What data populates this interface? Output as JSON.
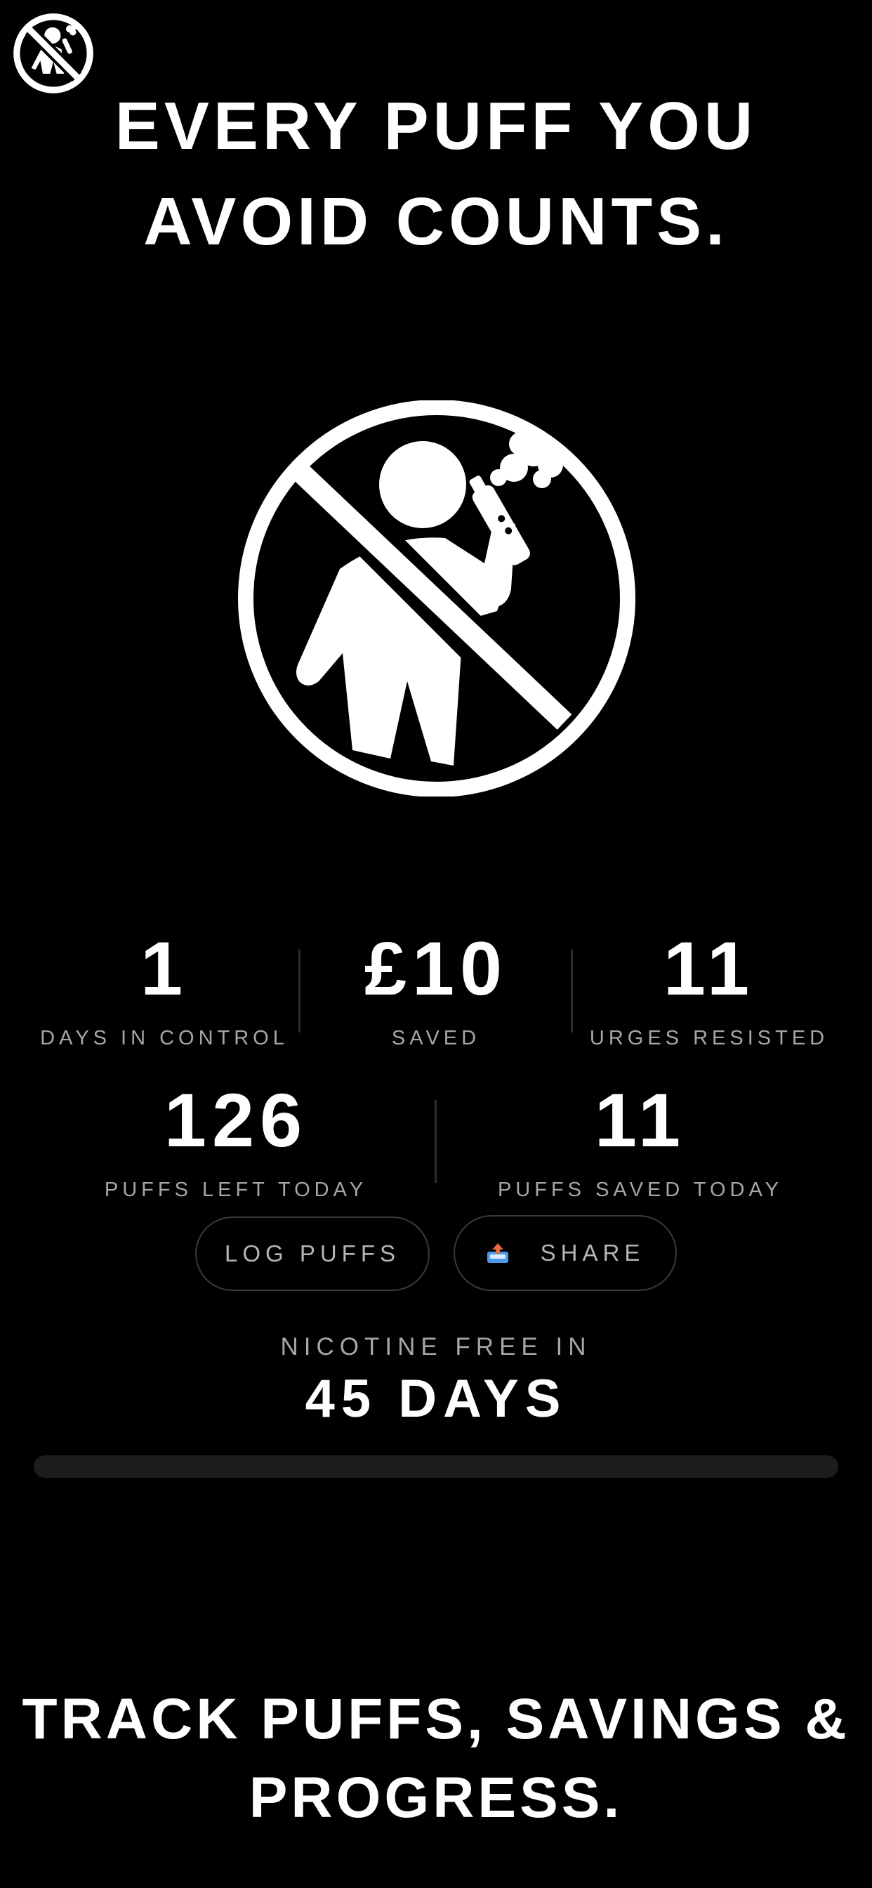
{
  "header": {
    "logo_icon": "no-vaping-icon",
    "headline_line1": "EVERY PUFF YOU",
    "headline_line2": "AVOID COUNTS."
  },
  "hero": {
    "icon": "no-vaping-icon"
  },
  "stats_row1": [
    {
      "value": "1",
      "label": "DAYS IN CONTROL"
    },
    {
      "value": "£10",
      "label": "SAVED"
    },
    {
      "value": "11",
      "label": "URGES RESISTED"
    }
  ],
  "stats_row2": [
    {
      "value": "126",
      "label": "PUFFS LEFT TODAY"
    },
    {
      "value": "11",
      "label": "PUFFS SAVED TODAY"
    }
  ],
  "actions": {
    "log_label": "LOG PUFFS",
    "share_label": "SHARE",
    "share_icon": "outbox-tray-icon"
  },
  "nicotine_free": {
    "label": "NICOTINE FREE IN",
    "value": "45 DAYS",
    "progress": 0
  },
  "footer": {
    "headline_line1": "TRACK PUFFS, SAVINGS &",
    "headline_line2": "PROGRESS."
  },
  "colors": {
    "background": "#000000",
    "text": "#ffffff",
    "muted_text": "#a6a6a6",
    "track": "#1c1c1c",
    "pill_border": "#3a3a3a",
    "share_icon_blue": "#3b8fe0"
  }
}
